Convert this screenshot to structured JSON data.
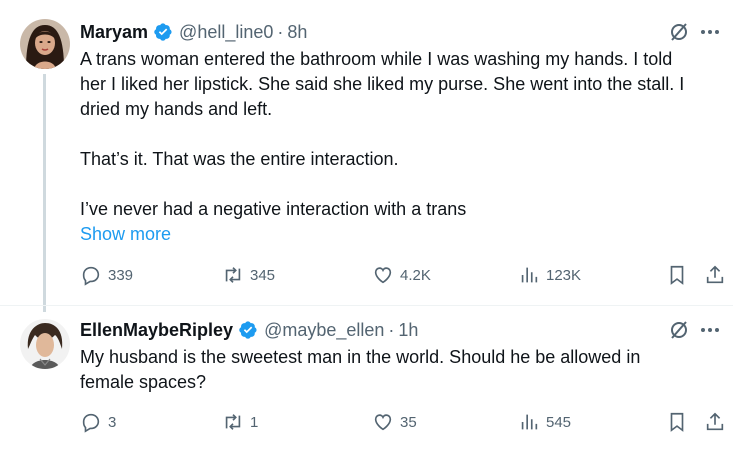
{
  "tweets": [
    {
      "name": "Maryam",
      "handle": "@hell_line0",
      "separator": "·",
      "time": "8h",
      "body_lines": [
        "A trans woman entered the bathroom while I was washing my hands. I told",
        "her I liked her lipstick. She said she liked my purse. She went into the stall. I",
        "dried my hands and left.",
        "",
        "That’s it. That was the entire interaction.",
        "",
        "I’ve never had a negative interaction with a trans"
      ],
      "show_more": "Show more",
      "stats": {
        "replies": "339",
        "reposts": "345",
        "likes": "4.2K",
        "views": "123K"
      }
    },
    {
      "name": "EllenMaybeRipley",
      "handle": "@maybe_ellen",
      "separator": "·",
      "time": "1h",
      "body_lines": [
        "My husband is the sweetest man in the world. Should he be allowed in",
        "female spaces?"
      ],
      "stats": {
        "replies": "3",
        "reposts": "1",
        "likes": "35",
        "views": "545"
      }
    }
  ],
  "colors": {
    "text": "#0f1419",
    "secondary": "#536471",
    "accent": "#1d9bf0",
    "thread_line": "#cfd9de"
  },
  "icons": [
    "verified-badge-icon",
    "grok-icon",
    "more-icon",
    "reply-icon",
    "repost-icon",
    "like-icon",
    "views-icon",
    "bookmark-icon",
    "share-icon"
  ]
}
